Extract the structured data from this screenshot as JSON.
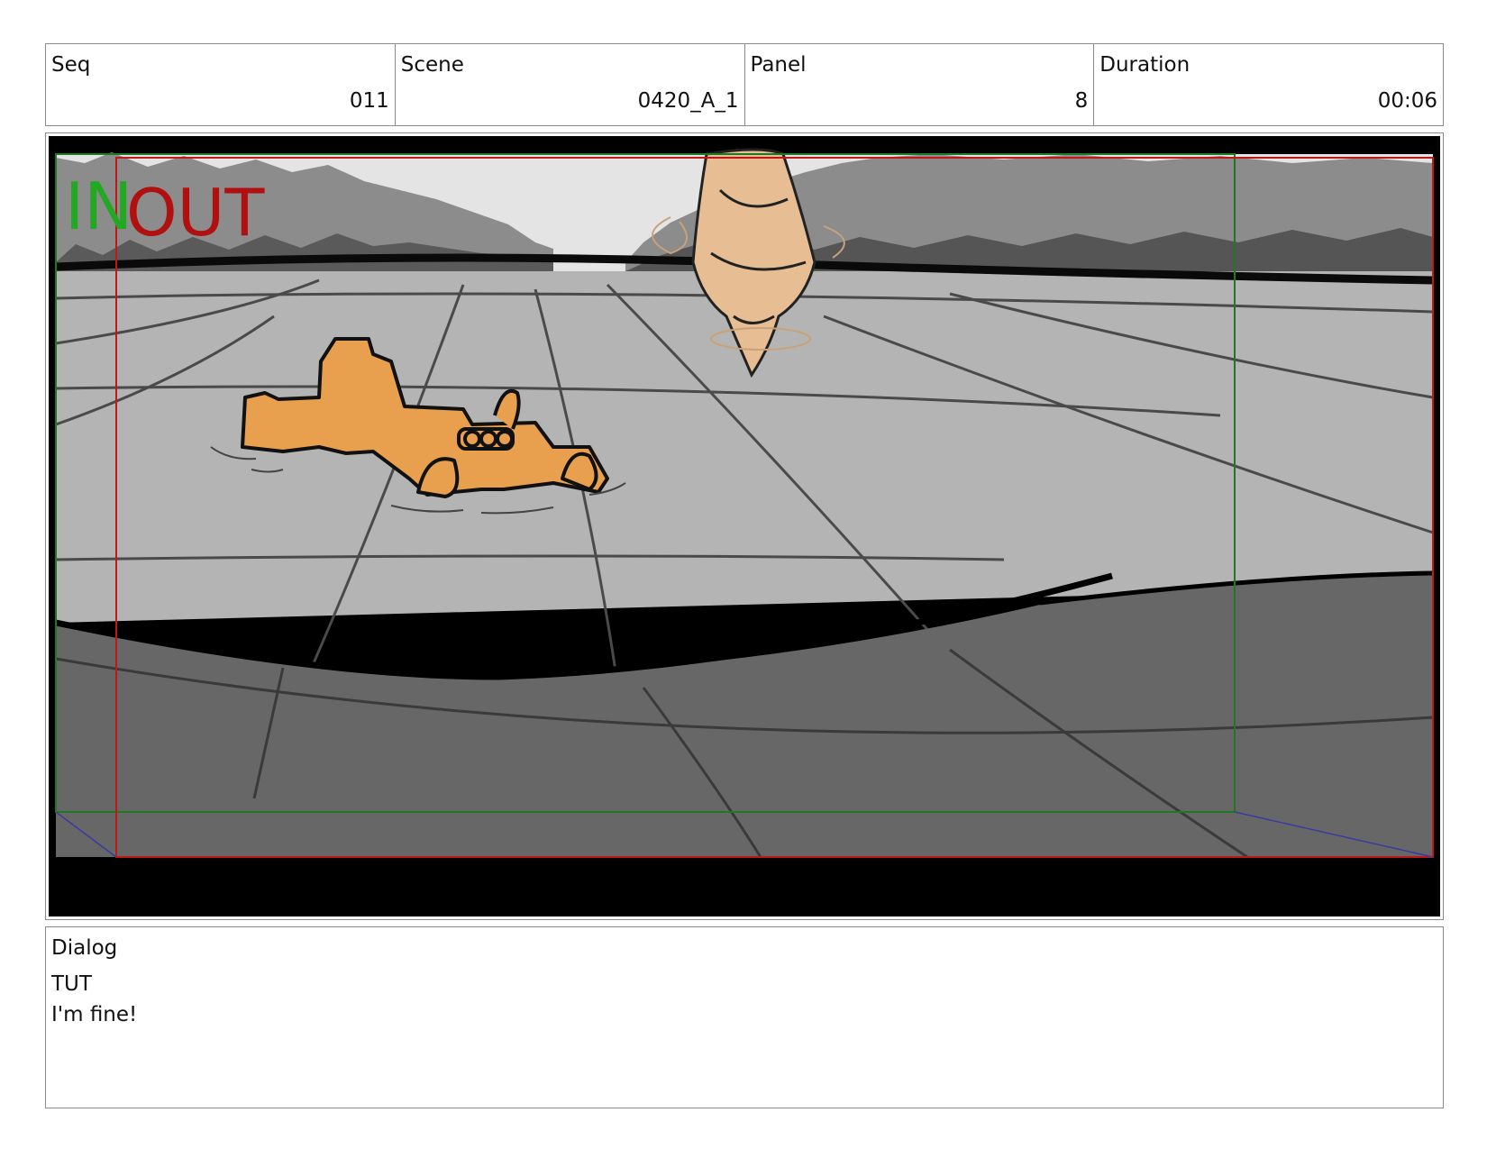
{
  "header": {
    "seq": {
      "label": "Seq",
      "value": "011"
    },
    "scene": {
      "label": "Scene",
      "value": "0420_A_1"
    },
    "panel": {
      "label": "Panel",
      "value": "8"
    },
    "duration": {
      "label": "Duration",
      "value": "00:06"
    }
  },
  "frame": {
    "in_marker": "IN",
    "out_marker": "OUT",
    "colors": {
      "in_marker": "#22a822",
      "out_marker": "#b01010",
      "safe_green": "#1f7a1f",
      "safe_red": "#c01818",
      "ice": "#b4b4b4",
      "water": "#676767",
      "vehicle": "#e8a04f",
      "character": "#e7bd94"
    }
  },
  "dialog": {
    "label": "Dialog",
    "speaker": "TUT",
    "line": "I'm fine!"
  }
}
